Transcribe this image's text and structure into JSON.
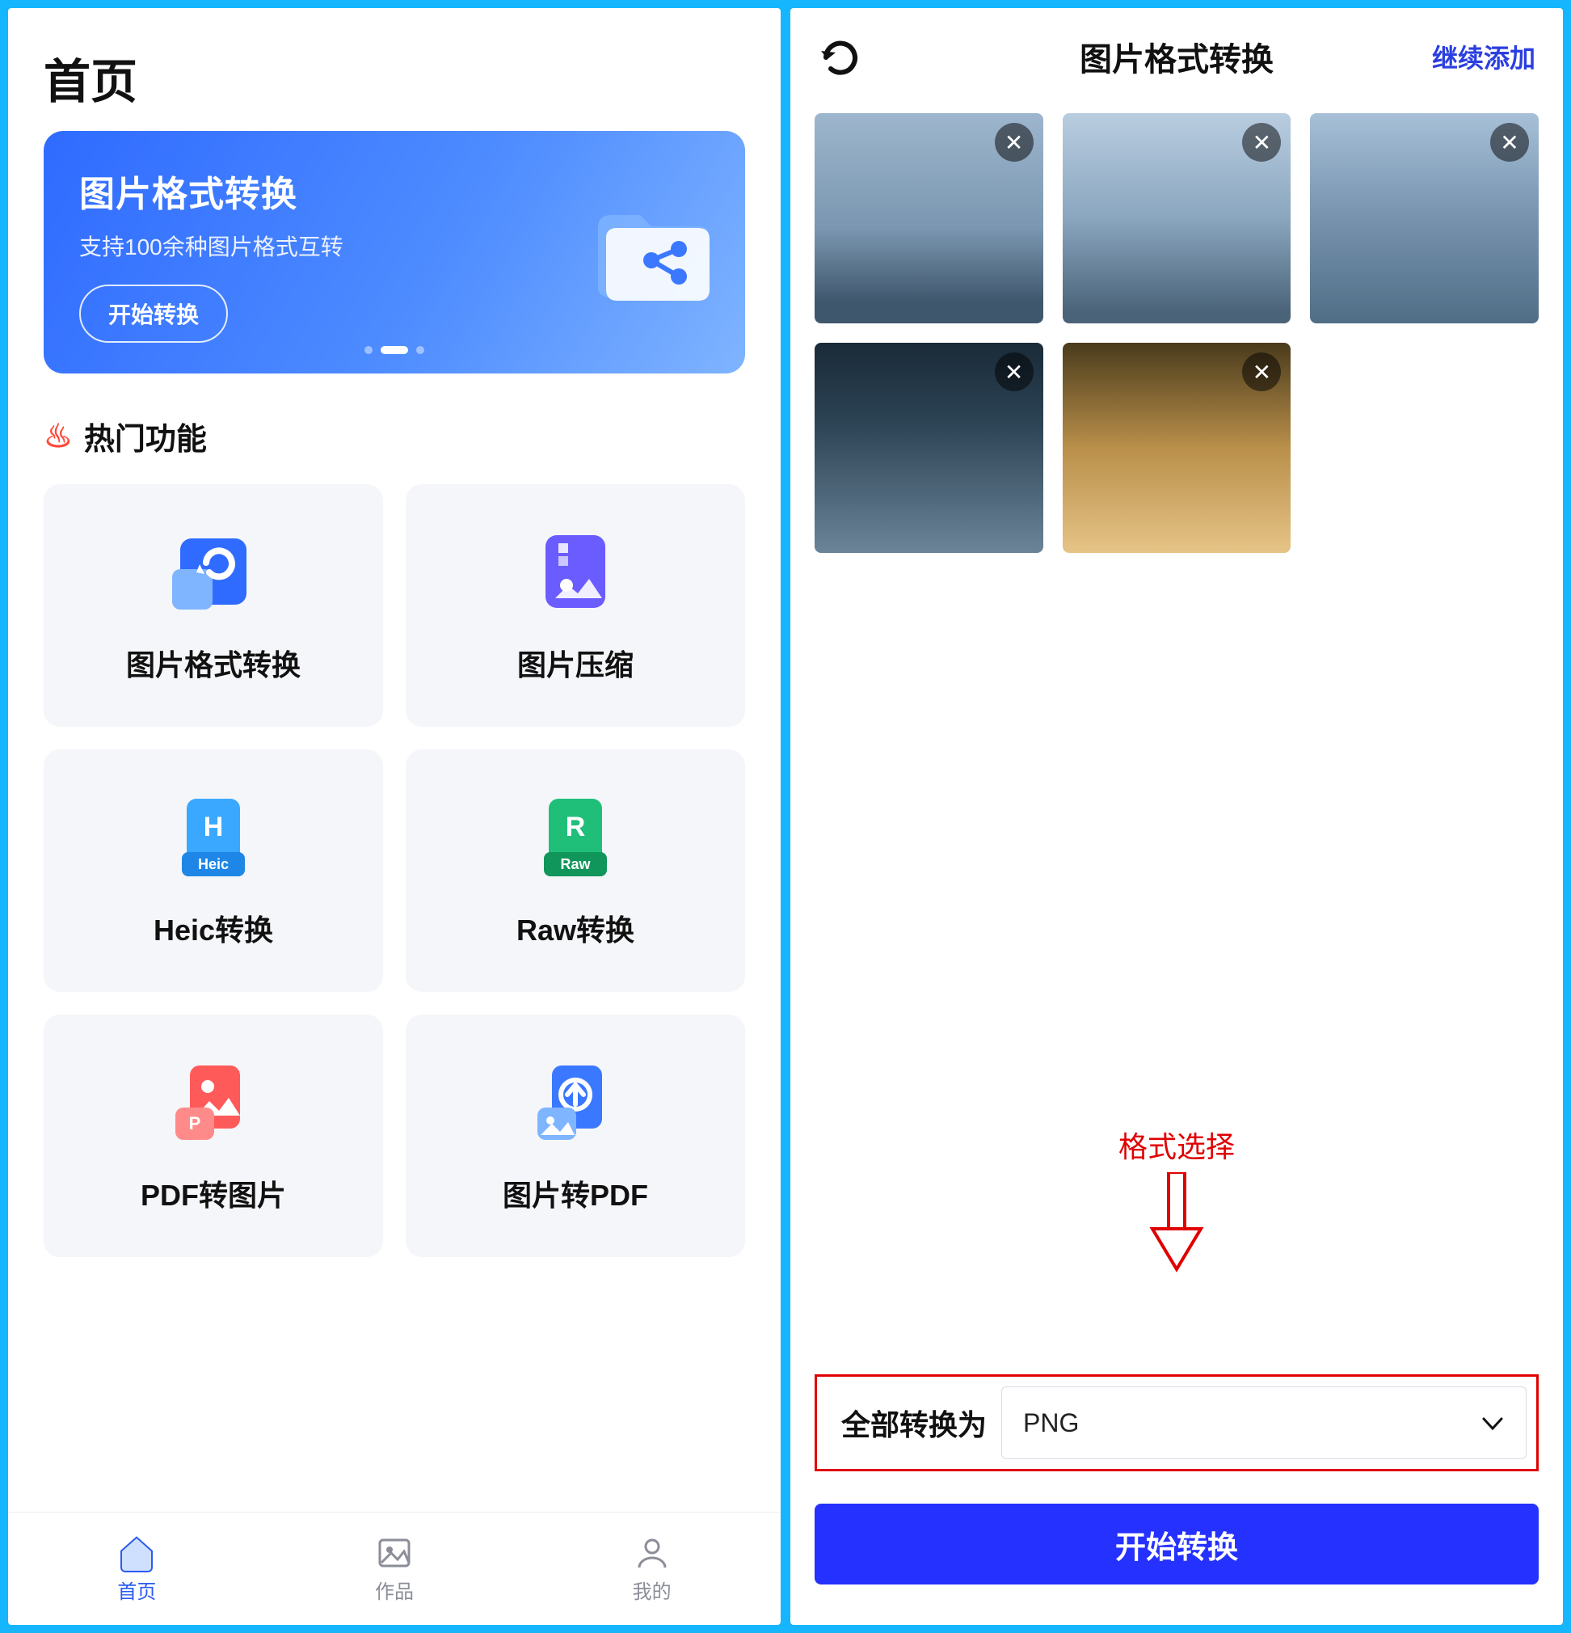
{
  "home": {
    "title": "首页",
    "banner": {
      "title": "图片格式转换",
      "subtitle": "支持100余种图片格式互转",
      "button": "开始转换"
    },
    "section_title": "热门功能",
    "features": [
      {
        "label": "图片格式转换",
        "icon": "convert"
      },
      {
        "label": "图片压缩",
        "icon": "compress"
      },
      {
        "label": "Heic转换",
        "icon": "heic"
      },
      {
        "label": "Raw转换",
        "icon": "raw"
      },
      {
        "label": "PDF转图片",
        "icon": "pdf2img"
      },
      {
        "label": "图片转PDF",
        "icon": "img2pdf"
      }
    ],
    "tabs": [
      {
        "label": "首页",
        "icon": "home",
        "active": true
      },
      {
        "label": "作品",
        "icon": "works",
        "active": false
      },
      {
        "label": "我的",
        "icon": "mine",
        "active": false
      }
    ]
  },
  "convert": {
    "title": "图片格式转换",
    "add_more": "继续添加",
    "thumbs": [
      "t1",
      "t2",
      "t3",
      "t4",
      "t5"
    ],
    "annotation": "格式选择",
    "format_label": "全部转换为",
    "format_value": "PNG",
    "start_button": "开始转换"
  }
}
